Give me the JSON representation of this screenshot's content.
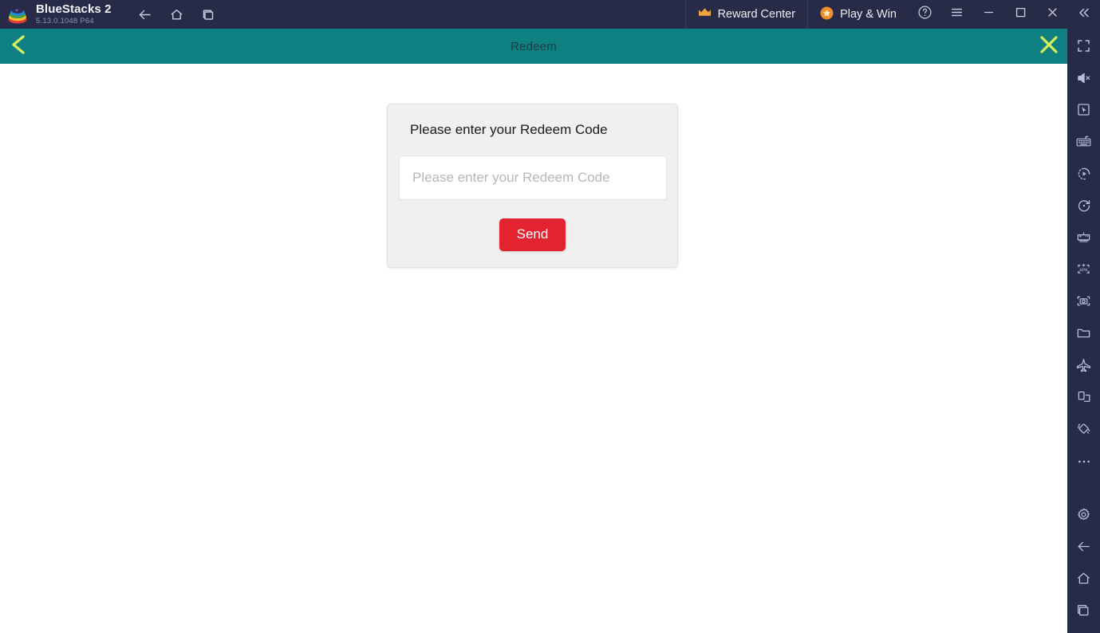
{
  "titlebar": {
    "logo_icon": "bluestacks-layered-logo",
    "brand_name": "BlueStacks 2",
    "version": "5.13.0.1048  P64",
    "nav": [
      {
        "icon": "back-arrow-icon",
        "name": "back"
      },
      {
        "icon": "home-icon",
        "name": "home"
      },
      {
        "icon": "recents-icon",
        "name": "recents"
      }
    ],
    "promos": [
      {
        "label": "Reward Center",
        "icon": "crown-icon",
        "color": "#f0a33c"
      },
      {
        "label": "Play & Win",
        "icon": "star-badge-icon",
        "color": "#f28c28"
      }
    ],
    "window_controls": [
      {
        "icon": "help-icon",
        "name": "help"
      },
      {
        "icon": "hamburger-menu-icon",
        "name": "menu"
      },
      {
        "icon": "minimize-icon",
        "name": "minimize"
      },
      {
        "icon": "maximize-icon",
        "name": "maximize"
      },
      {
        "icon": "close-icon",
        "name": "close"
      },
      {
        "icon": "collapse-double-chevron-icon",
        "name": "collapse"
      }
    ]
  },
  "app_header": {
    "title": "Redeem",
    "back_icon": "back-chevron-icon",
    "close_icon": "close-x-icon",
    "bg_color": "#0e8081",
    "accent_color": "#d4f05a"
  },
  "dialog": {
    "title": "Please enter your Redeem Code",
    "input_placeholder": "Please enter your Redeem Code",
    "input_value": "",
    "send_label": "Send",
    "send_color": "#e32430"
  },
  "sidebar": {
    "items": [
      {
        "icon": "fullscreen-icon",
        "name": "fullscreen"
      },
      {
        "icon": "mute-icon",
        "name": "mute"
      },
      {
        "icon": "cursor-pointer-icon",
        "name": "pointer-mode"
      },
      {
        "icon": "keyboard-icon",
        "name": "game-controls"
      },
      {
        "icon": "macro-record-icon",
        "name": "macro-recorder"
      },
      {
        "icon": "rotate-icon",
        "name": "rotate"
      },
      {
        "icon": "gamepad-icon",
        "name": "gamepad"
      },
      {
        "icon": "apk-install-icon",
        "name": "install-apk"
      },
      {
        "icon": "screenshot-icon",
        "name": "screenshot"
      },
      {
        "icon": "folder-icon",
        "name": "media-manager"
      },
      {
        "icon": "airplane-icon",
        "name": "eco-mode"
      },
      {
        "icon": "multi-instance-icon",
        "name": "multi-instance"
      },
      {
        "icon": "shake-icon",
        "name": "shake"
      },
      {
        "icon": "more-ellipsis-icon",
        "name": "more"
      }
    ],
    "bottom_items": [
      {
        "icon": "gear-icon",
        "name": "settings"
      },
      {
        "icon": "back-arrow-icon",
        "name": "android-back"
      },
      {
        "icon": "home-icon",
        "name": "android-home"
      },
      {
        "icon": "recents-icon",
        "name": "android-recents"
      }
    ]
  }
}
